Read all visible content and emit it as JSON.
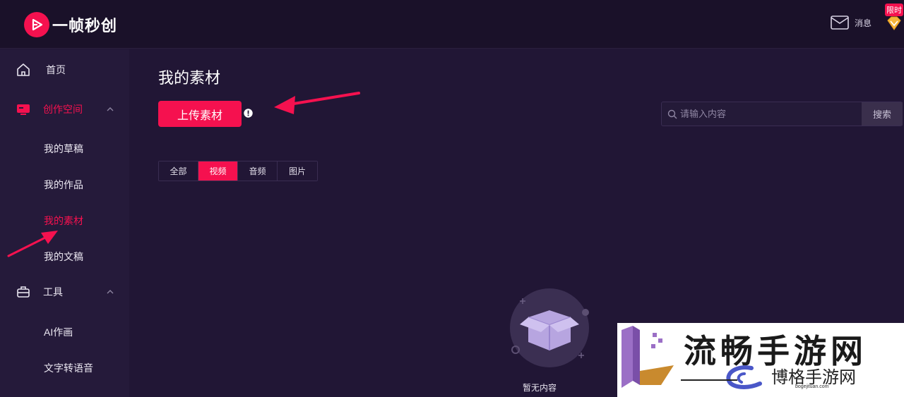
{
  "app": {
    "name": "一帧秒创"
  },
  "header": {
    "message_label": "消息",
    "vip_badge": "限时"
  },
  "sidebar": {
    "home": "首页",
    "create_space": "创作空间",
    "create_children": [
      "我的草稿",
      "我的作品",
      "我的素材",
      "我的文稿"
    ],
    "tools": "工具",
    "tools_children": [
      "AI作画",
      "文字转语音"
    ]
  },
  "main": {
    "title": "我的素材",
    "upload_label": "上传素材",
    "search": {
      "placeholder": "请输入内容",
      "button": "搜索"
    },
    "tabs": [
      "全部",
      "视频",
      "音频",
      "图片"
    ],
    "active_tab": "视频",
    "empty_text": "暂无内容"
  },
  "watermark": {
    "title": "流畅手游网",
    "subtitle": "博格手游网",
    "url": "bogejituan.com"
  },
  "colors": {
    "accent": "#f5114f",
    "background": "#211635",
    "sidebar": "#251a3a",
    "topbar": "#1a1129"
  }
}
